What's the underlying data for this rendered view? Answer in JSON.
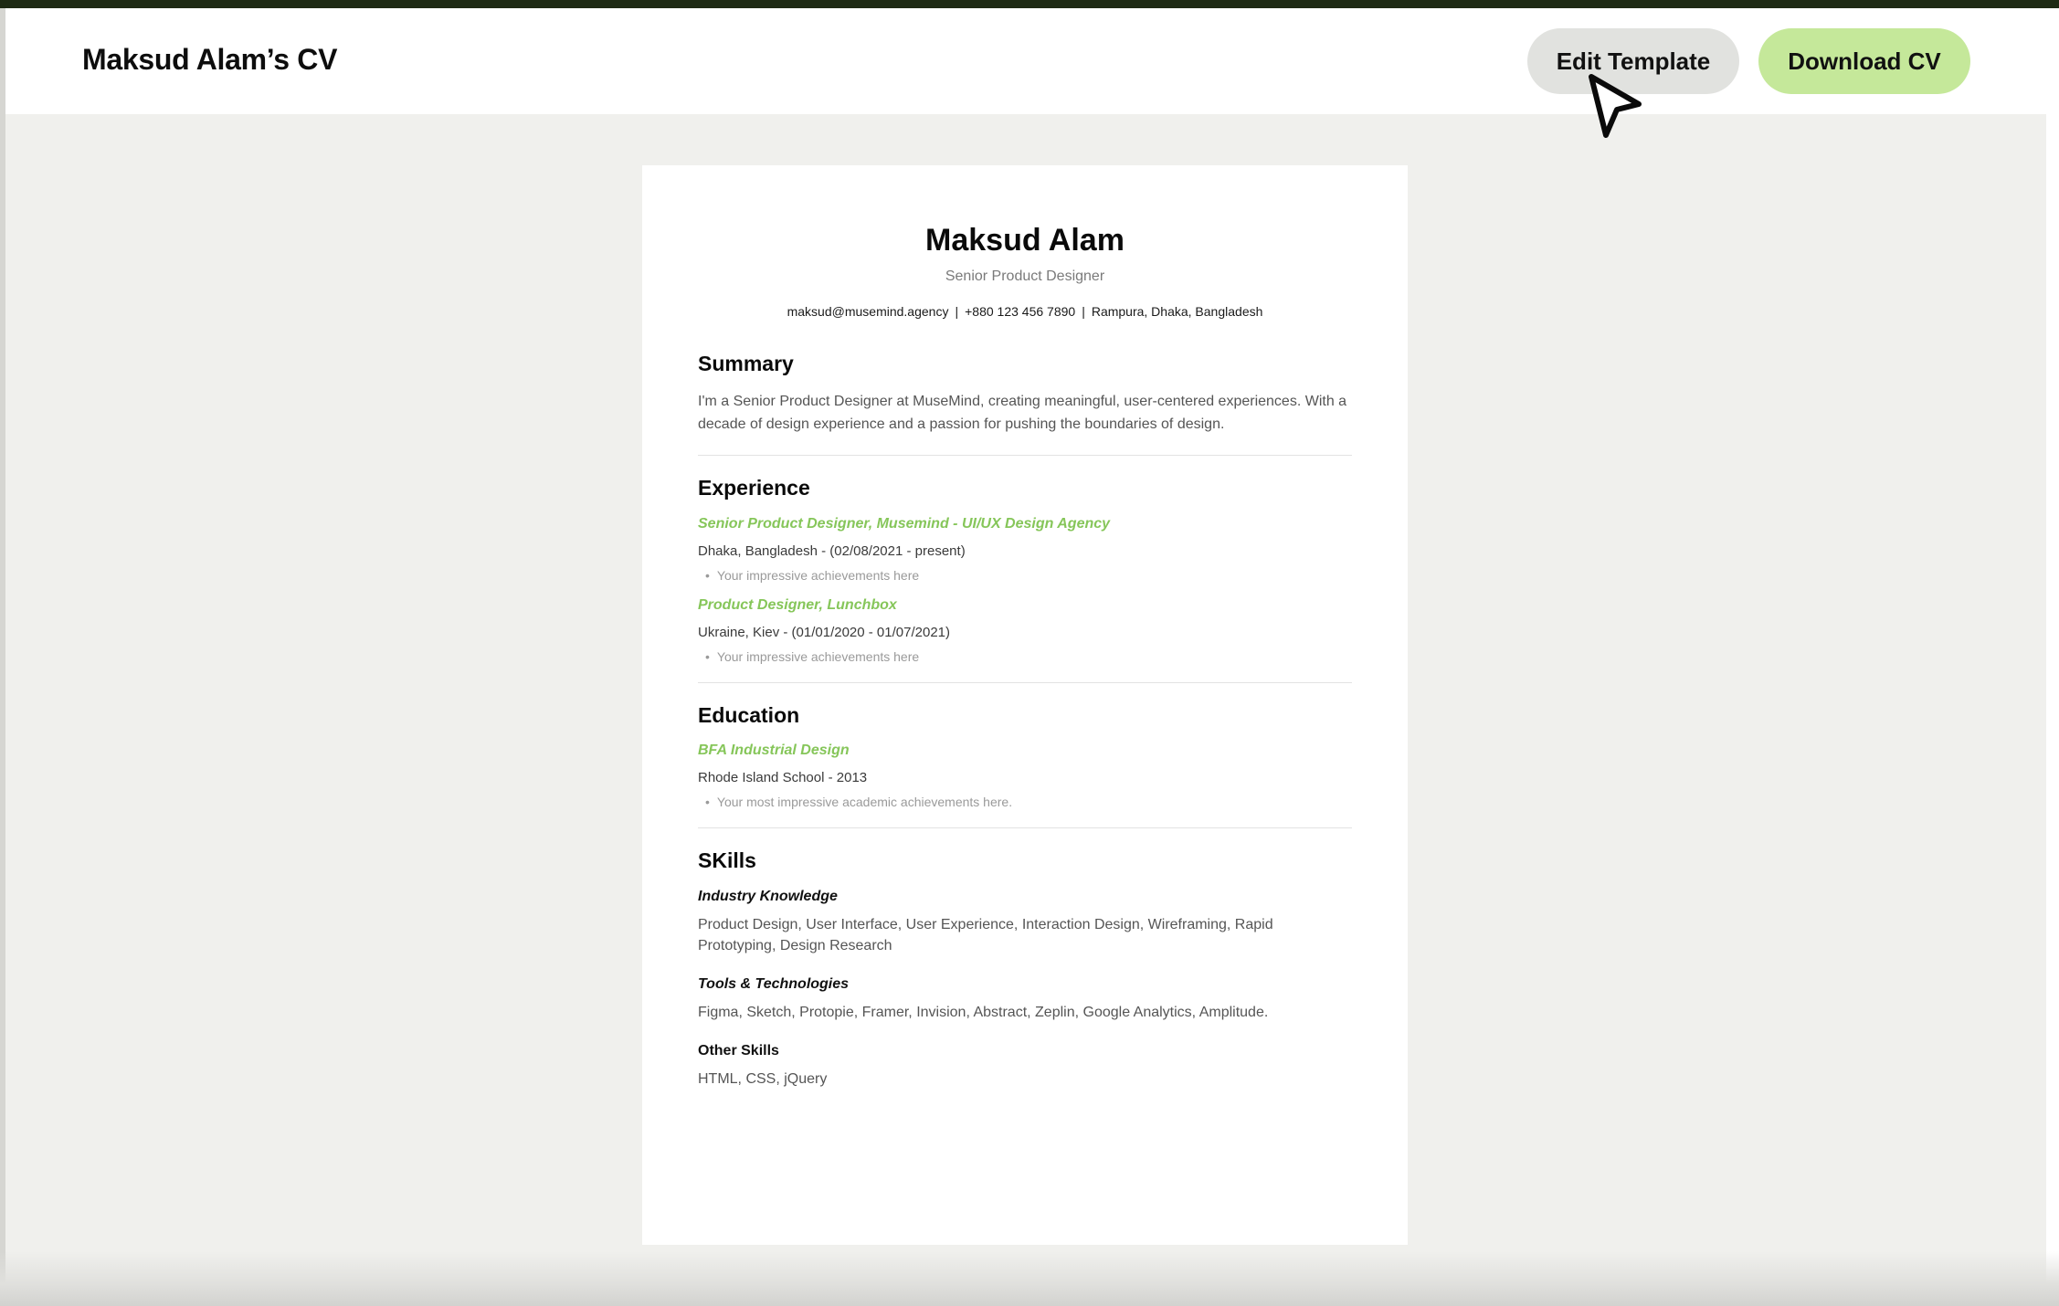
{
  "header": {
    "title": "Maksud Alam’s CV",
    "edit_label": "Edit Template",
    "download_label": "Download CV"
  },
  "colors": {
    "accent_green": "#c5e89a",
    "link_green": "#86c65a",
    "top_strip": "#1e2a14"
  },
  "cv": {
    "name": "Maksud Alam",
    "role": "Senior Product Designer",
    "contact": {
      "email": "maksud@musemind.agency",
      "phone": "+880 123 456 7890",
      "location": "Rampura, Dhaka, Bangladesh",
      "separator": "|"
    },
    "summary": {
      "heading": "Summary",
      "text": "I'm a Senior Product Designer at MuseMind, creating meaningful, user-centered experiences. With a decade of design experience and a passion for pushing the boundaries of design."
    },
    "experience": {
      "heading": "Experience",
      "jobs": [
        {
          "title": "Senior Product Designer, Musemind - UI/UX Design Agency",
          "meta": "Dhaka, Bangladesh - (02/08/2021 - present)",
          "bullet": "Your impressive achievements here"
        },
        {
          "title": "Product Designer, Lunchbox",
          "meta": "Ukraine, Kiev - (01/01/2020 - 01/07/2021)",
          "bullet": "Your impressive achievements here"
        }
      ]
    },
    "education": {
      "heading": "Education",
      "degree": "BFA Industrial Design",
      "meta": "Rhode Island School - 2013",
      "bullet": "Your most impressive academic achievements here."
    },
    "skills": {
      "heading": "SKills",
      "groups": [
        {
          "title": "Industry Knowledge",
          "text": "Product Design, User Interface, User Experience, Interaction Design, Wireframing, Rapid Prototyping, Design Research"
        },
        {
          "title": "Tools & Technologies",
          "text": "Figma, Sketch, Protopie, Framer, Invision, Abstract, Zeplin, Google Analytics, Amplitude."
        },
        {
          "title": "Other Skills",
          "text": "HTML, CSS, jQuery"
        }
      ]
    },
    "bullet_glyph": "•"
  },
  "cursor": {
    "icon": "mouse-pointer-icon"
  }
}
